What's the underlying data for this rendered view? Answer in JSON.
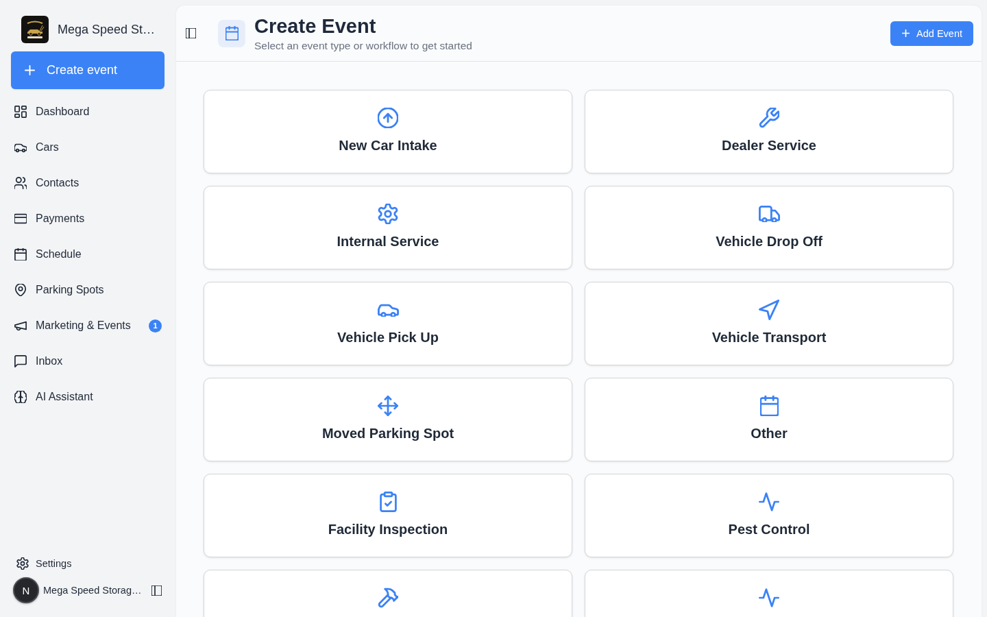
{
  "sidebar": {
    "brand": {
      "name": "Mega Speed St…"
    },
    "create_button": {
      "label": "Create event"
    },
    "nav": [
      {
        "label": "Dashboard"
      },
      {
        "label": "Cars"
      },
      {
        "label": "Contacts"
      },
      {
        "label": "Payments"
      },
      {
        "label": "Schedule"
      },
      {
        "label": "Parking Spots"
      },
      {
        "label": "Marketing & Events",
        "badge": "1"
      },
      {
        "label": "Inbox"
      },
      {
        "label": "AI Assistant"
      }
    ],
    "footer": {
      "settings": {
        "label": "Settings"
      },
      "account": {
        "initial": "N",
        "name": "Mega Speed Storag…"
      }
    }
  },
  "header": {
    "title": "Create Event",
    "subtitle": "Select an event type or workflow to get started",
    "add_button": {
      "label": "Add Event"
    }
  },
  "event_types": [
    {
      "kind": "labeled",
      "label": "New Car Intake"
    },
    {
      "kind": "labeled",
      "label": "Dealer Service"
    },
    {
      "kind": "labeled",
      "label": "Internal Service"
    },
    {
      "kind": "labeled",
      "label": "Vehicle Drop Off"
    },
    {
      "kind": "labeled",
      "label": "Vehicle Pick Up"
    },
    {
      "kind": "labeled",
      "label": "Vehicle Transport"
    },
    {
      "kind": "labeled",
      "label": "Moved Parking Spot"
    },
    {
      "kind": "labeled",
      "label": "Other"
    },
    {
      "kind": "labeled",
      "label": "Facility Inspection"
    },
    {
      "kind": "labeled",
      "label": "Pest Control"
    },
    {
      "kind": "cut_off"
    },
    {
      "kind": "cut_off"
    }
  ]
}
